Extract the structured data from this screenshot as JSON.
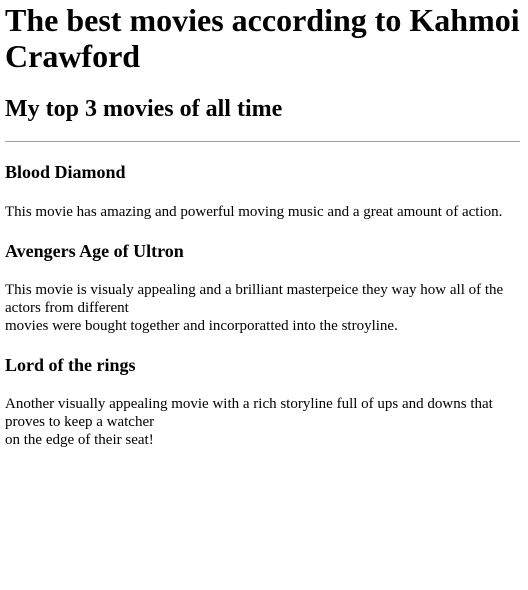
{
  "page": {
    "title": "The best movies according to Kahmoi Crawford",
    "subtitle": "My top 3 movies of all time"
  },
  "movies": [
    {
      "title": "Blood Diamond",
      "description_lines": [
        "This movie has amazing and powerful moving music and a great amount of action."
      ]
    },
    {
      "title": "Avengers Age of Ultron",
      "description_lines": [
        "This movie is visualy appealing and a brilliant masterpeice they way how all of the actors from different",
        "movies were bought together and incorporatted into the stroyline."
      ]
    },
    {
      "title": "Lord of the rings",
      "description_lines": [
        "Another visually appealing movie with a rich storyline full of ups and downs that proves to keep a watcher",
        "on the edge of their seat!"
      ]
    }
  ]
}
